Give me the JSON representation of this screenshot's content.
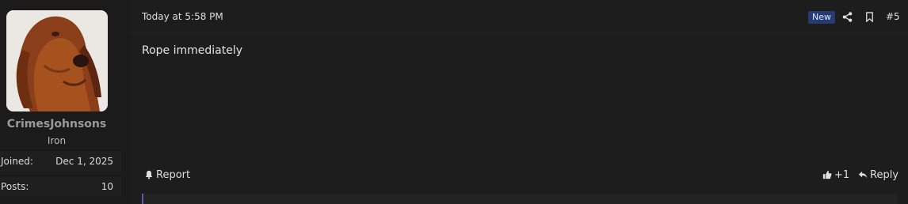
{
  "user": {
    "name": "CrimesJohnsons",
    "title": "Iron",
    "avatar_icon": "bloodhound-avatar",
    "stats": [
      {
        "label": "Joined:",
        "value": "Dec 1, 2025"
      },
      {
        "label": "Posts:",
        "value": "10"
      }
    ]
  },
  "post": {
    "timestamp": "Today at 5:58 PM",
    "badge": "New",
    "number": "#5",
    "body": "Rope immediately",
    "actions": {
      "report": "Report",
      "like": "+1",
      "reply": "Reply"
    },
    "colors": {
      "badge_bg": "#253b74",
      "quote_bar": "#5d5ab0"
    },
    "icons": [
      "share-icon",
      "bookmark-icon",
      "bell-icon",
      "thumbs-up-icon",
      "reply-arrow-icon"
    ]
  }
}
